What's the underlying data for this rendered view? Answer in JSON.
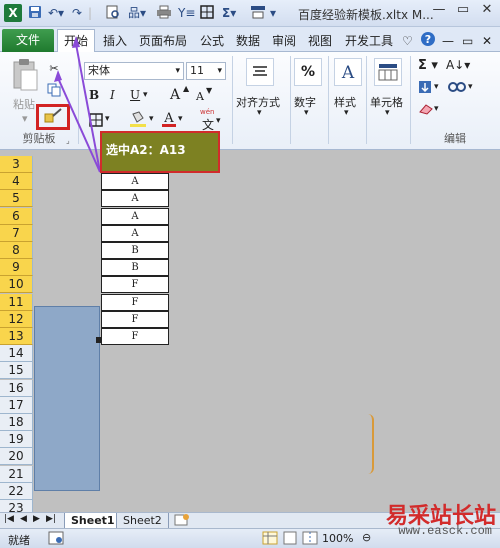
{
  "window": {
    "app_icon": "X",
    "title": "百度经验新模板.xltx M...",
    "controls": [
      "—",
      "▭",
      "✕"
    ]
  },
  "quick_access": [
    "save-icon",
    "undo-icon",
    "redo-icon",
    "print-preview-icon",
    "format-icon",
    "sort-filter-icon",
    "borders-icon",
    "sum-icon",
    "insert-icon"
  ],
  "tabs": {
    "file": "文件",
    "home": "开始",
    "items": [
      "插入",
      "页面布局",
      "公式",
      "数据",
      "审阅",
      "视图",
      "开发工具"
    ]
  },
  "ribbon": {
    "clipboard": {
      "paste": "粘贴",
      "group_label": "剪贴板"
    },
    "font": {
      "name": "宋体",
      "size": "11",
      "bold": "B",
      "italic": "I",
      "underline": "U",
      "grow": "A",
      "shrink": "A",
      "wen": "wén",
      "wen_char": "文"
    },
    "alignment": {
      "label": "对齐方式"
    },
    "number": {
      "label": "数字",
      "symbol": "%"
    },
    "styles": {
      "label": "样式"
    },
    "cells": {
      "label": "单元格"
    },
    "editing": {
      "label": "编辑"
    }
  },
  "callout": {
    "text": "选中A2：A13"
  },
  "rows": [
    {
      "n": "3",
      "selected": true,
      "value": ""
    },
    {
      "n": "4",
      "selected": true,
      "value": "A"
    },
    {
      "n": "5",
      "selected": true,
      "value": "A"
    },
    {
      "n": "6",
      "selected": true,
      "value": "A"
    },
    {
      "n": "7",
      "selected": true,
      "value": "A"
    },
    {
      "n": "8",
      "selected": true,
      "value": "B"
    },
    {
      "n": "9",
      "selected": true,
      "value": "B"
    },
    {
      "n": "10",
      "selected": true,
      "value": "F"
    },
    {
      "n": "11",
      "selected": true,
      "value": "F"
    },
    {
      "n": "12",
      "selected": true,
      "value": "F"
    },
    {
      "n": "13",
      "selected": true,
      "value": "F"
    },
    {
      "n": "14",
      "selected": false,
      "value": null
    },
    {
      "n": "15",
      "selected": false,
      "value": null
    },
    {
      "n": "16",
      "selected": false,
      "value": null
    },
    {
      "n": "17",
      "selected": false,
      "value": null
    },
    {
      "n": "18",
      "selected": false,
      "value": null
    },
    {
      "n": "19",
      "selected": false,
      "value": null
    },
    {
      "n": "20",
      "selected": false,
      "value": null
    },
    {
      "n": "21",
      "selected": false,
      "value": null
    },
    {
      "n": "22",
      "selected": false,
      "value": null
    },
    {
      "n": "23",
      "selected": false,
      "value": null
    }
  ],
  "sheets": {
    "tabs": [
      "Sheet1",
      "Sheet2"
    ],
    "nav": [
      "|◀",
      "◀",
      "▶",
      "▶|"
    ]
  },
  "status": {
    "ready": "就绪",
    "zoom": "100%"
  },
  "watermark": {
    "text": "易采站长站",
    "url": "www.easck.com"
  },
  "colors": {
    "accent": "#1f7a2e",
    "selection": "#8ea8c8",
    "row_selected": "#f9d54c",
    "callout_bg": "#7d8122",
    "highlight_red": "#d12b2b"
  }
}
